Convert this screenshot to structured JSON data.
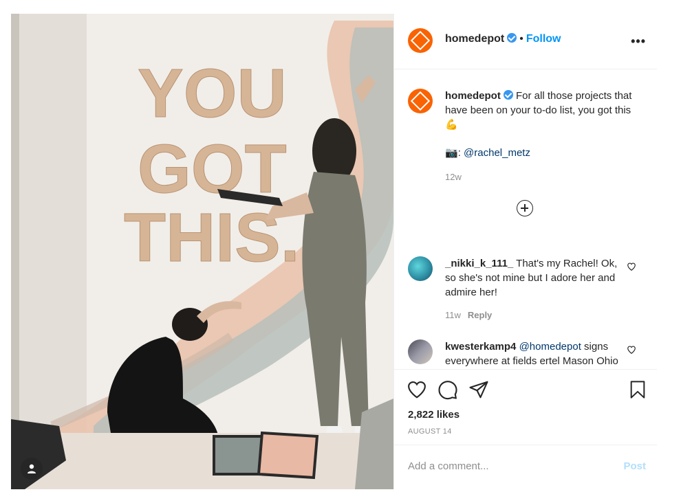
{
  "header": {
    "username": "homedepot",
    "separator": "•",
    "follow_label": "Follow",
    "more_label": "•••"
  },
  "caption": {
    "username": "homedepot",
    "text": "For all those projects that have been on your to-do list, you got this",
    "emoji": "💪",
    "camera_emoji": "📷",
    "credit_sep": ": ",
    "credit_mention": "@rachel_metz",
    "time": "12w"
  },
  "photo": {
    "sign_line1": "YOU",
    "sign_line2": "GOT",
    "sign_line3": "THIS."
  },
  "comments": [
    {
      "username": "_nikki_k_111_",
      "text": "That's my Rachel! Ok, so she's not mine but I adore her and admire her!",
      "time": "11w",
      "reply_label": "Reply"
    },
    {
      "username": "kwesterkamp4",
      "mention": "@homedepot",
      "text": "signs everywhere at fields ertel Mason Ohio store requiring"
    }
  ],
  "likes": "2,822 likes",
  "date": "AUGUST 14",
  "add_comment": {
    "placeholder": "Add a comment...",
    "post_label": "Post"
  },
  "colors": {
    "brand": "#f96302",
    "link": "#0095f6",
    "verified": "#3897f0"
  }
}
